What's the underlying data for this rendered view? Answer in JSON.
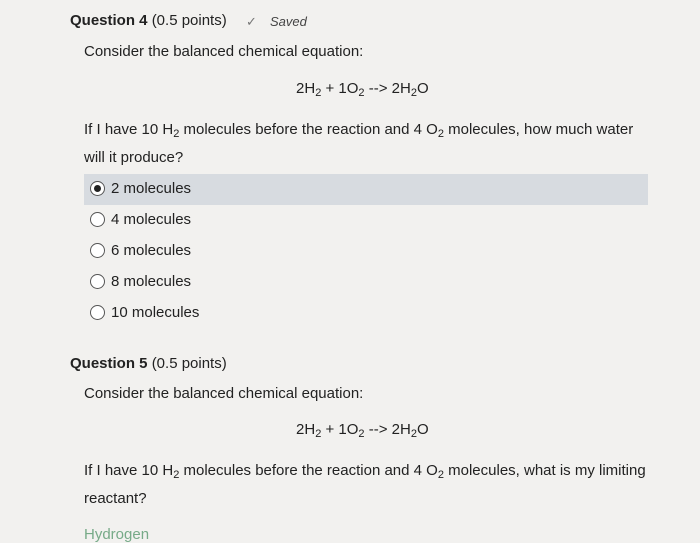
{
  "q4": {
    "title": "Question 4",
    "points": "(0.5 points)",
    "saved": "Saved",
    "prompt": "Consider the balanced chemical equation:",
    "equation": {
      "a": "2H",
      "a_sub": "2",
      "b": " + 1O",
      "b_sub": "2",
      "c": " --> 2H",
      "c_sub": "2",
      "d": "O"
    },
    "text": {
      "p1": "If I have 10 H",
      "s1": "2",
      "p2": " molecules before the reaction and 4 O",
      "s2": "2",
      "p3": " molecules, how much water will it produce?"
    },
    "choices": [
      {
        "label": "2 molecules",
        "selected": true
      },
      {
        "label": "4 molecules",
        "selected": false
      },
      {
        "label": "6 molecules",
        "selected": false
      },
      {
        "label": "8 molecules",
        "selected": false
      },
      {
        "label": "10 molecules",
        "selected": false
      }
    ]
  },
  "q5": {
    "title": "Question 5",
    "points": "(0.5 points)",
    "prompt": "Consider the balanced chemical equation:",
    "equation": {
      "a": "2H",
      "a_sub": "2",
      "b": " + 1O",
      "b_sub": "2",
      "c": " --> 2H",
      "c_sub": "2",
      "d": "O"
    },
    "text": {
      "p1": "If I have 10 H",
      "s1": "2",
      "p2": " molecules before the reaction and 4 O",
      "s2": "2",
      "p3": " molecules, what is my limiting reactant?"
    },
    "first_choice": "Hydrogen"
  }
}
